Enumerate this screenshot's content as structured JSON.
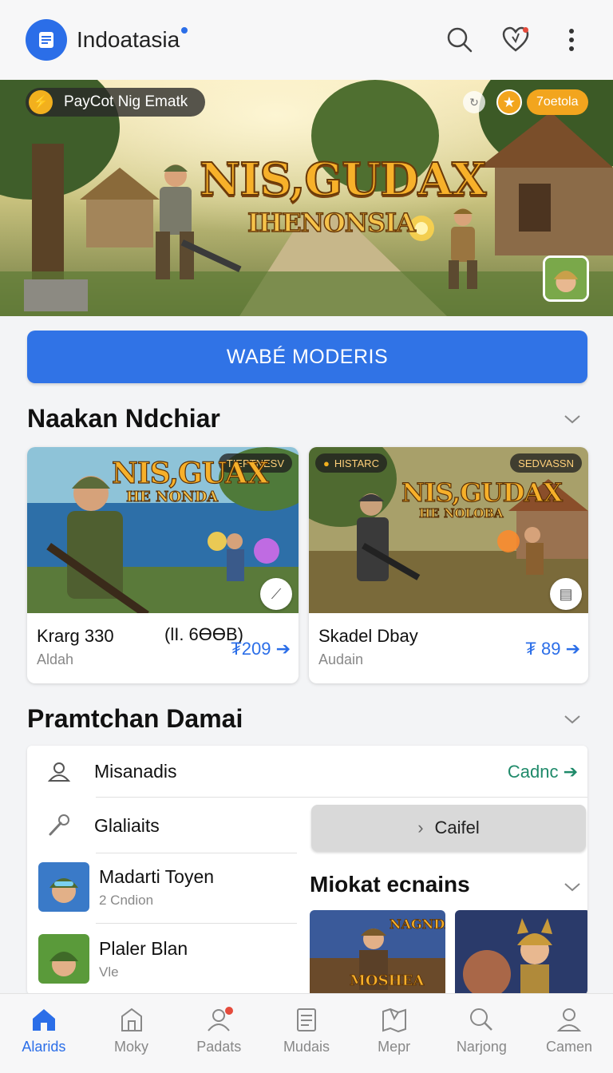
{
  "header": {
    "app_title": "Indoatasia",
    "icons": [
      "menu-doc-icon",
      "search-icon",
      "heart-icon",
      "more-icon"
    ]
  },
  "hero": {
    "pill_text": "PayCot Nig Ematk",
    "tag": "7oetola",
    "title": "NIS,GUDAX",
    "subtitle": "IHENONSIA"
  },
  "cta": {
    "label": "WABÉ MODERIS"
  },
  "section1": {
    "title": "Naakan Ndchiar",
    "cards": [
      {
        "art_title": "NIS,GUAX",
        "art_subtitle": "HE NONDA",
        "tag": "TIEPTNESV",
        "name": "Krarg 330",
        "extra": "(ƖI. 6ƟƟB)",
        "sub": "Aldah",
        "price": "₮209"
      },
      {
        "art_title": "NIS,GUDAX",
        "art_subtitle": "HE NOLOBA",
        "tag_left": "HISTARC",
        "tag": "SEDVASSN",
        "name": "Skadel Dbay",
        "sub": "Audain",
        "price": "₮ 89"
      }
    ]
  },
  "section2": {
    "title": "Pramtchan Damai",
    "rows": [
      {
        "label": "Misanadis",
        "link": "Cadnc"
      },
      {
        "label": "Glaliaits",
        "button": "Caifel"
      },
      {
        "label": "Madarti Toyen",
        "sub": "2 Cndion"
      },
      {
        "label": "Plaler Blan",
        "sub": "Vle"
      }
    ],
    "sub_section_title": "Miokat ecnains",
    "tile_text": "NAGNDA",
    "tile_text_2": "MOSHEA"
  },
  "bottom_nav": [
    {
      "label": "Alarids",
      "icon": "home-icon",
      "active": true
    },
    {
      "label": "Moky",
      "icon": "building-icon"
    },
    {
      "label": "Padats",
      "icon": "user-icon",
      "badge": true
    },
    {
      "label": "Mudais",
      "icon": "list-icon"
    },
    {
      "label": "Mepr",
      "icon": "map-icon"
    },
    {
      "label": "Narjong",
      "icon": "search-icon"
    },
    {
      "label": "Camen",
      "icon": "profile-icon"
    }
  ],
  "colors": {
    "accent": "#2b6ee8",
    "green_link": "#1f8a6a",
    "gold": "#f2a51e"
  }
}
